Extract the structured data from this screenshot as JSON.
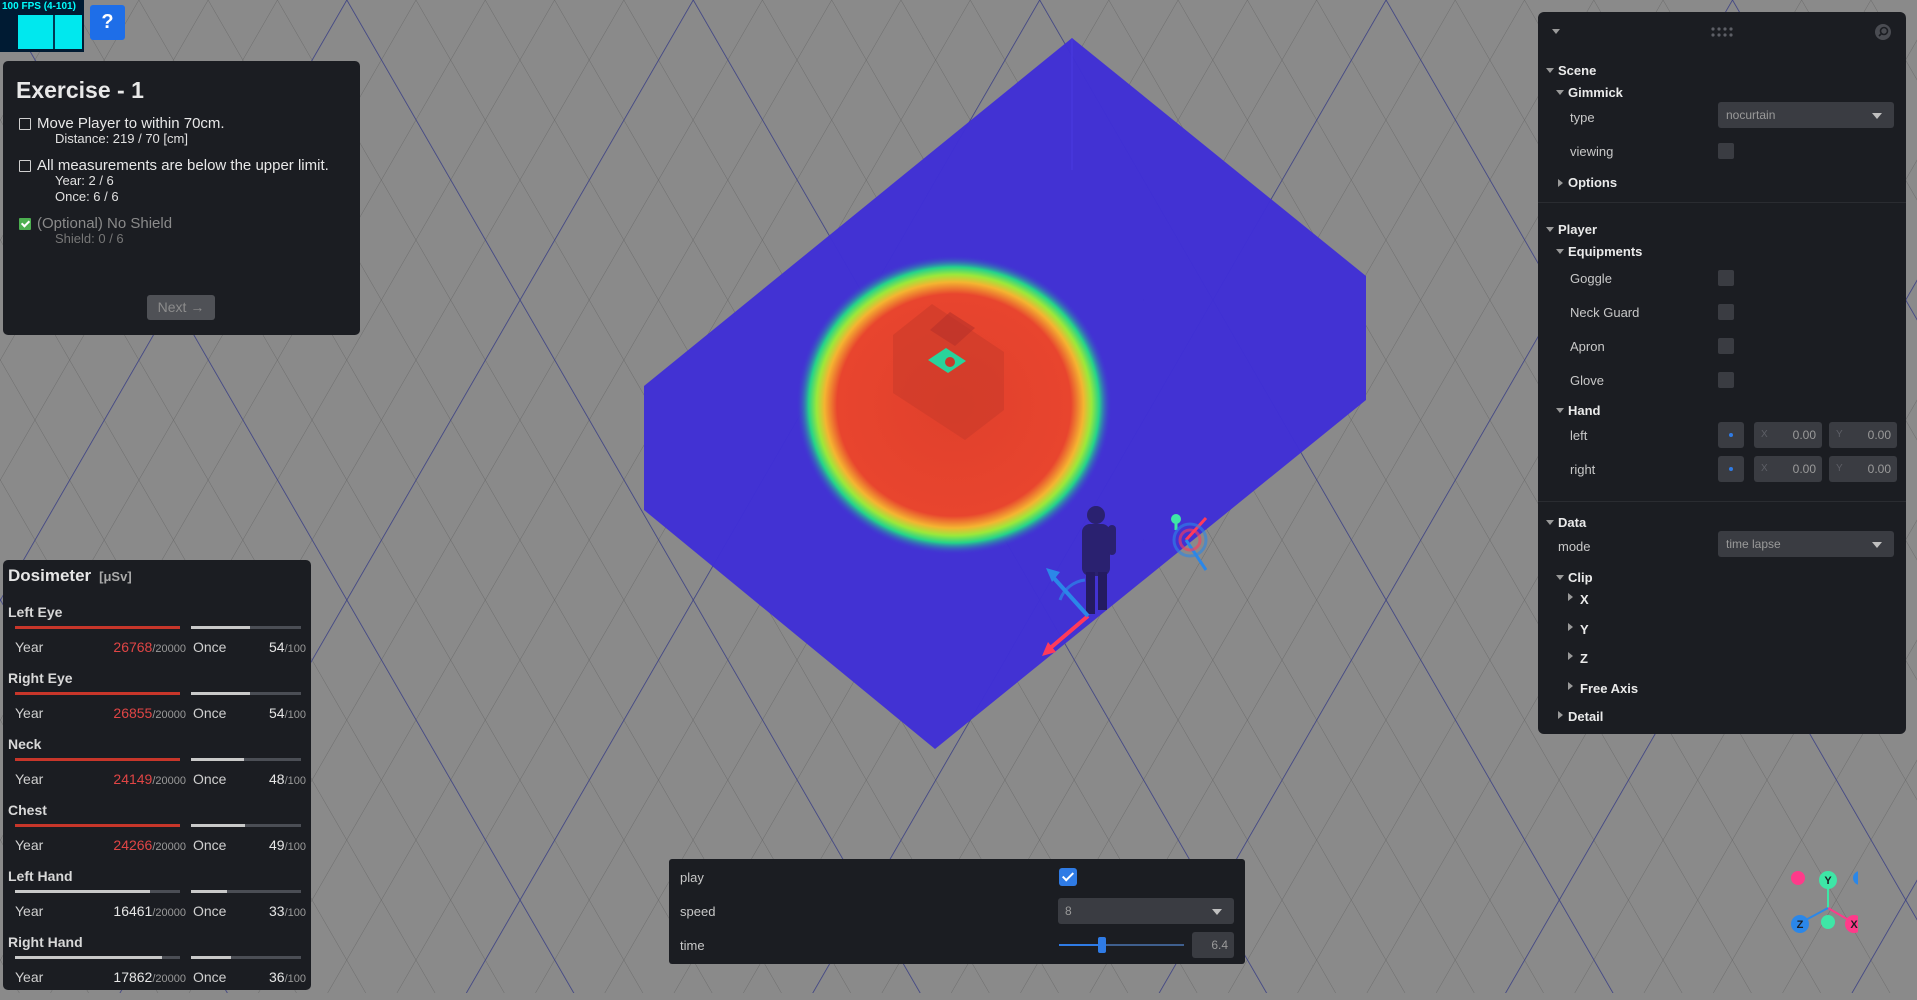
{
  "fps": {
    "label": "100 FPS (4-101)"
  },
  "help": {
    "label": "?"
  },
  "exercise": {
    "title": "Exercise - 1",
    "tasks": [
      {
        "label": "Move Player to within 70cm.",
        "details": [
          "Distance: 219 / 70 [cm]"
        ],
        "checked": false
      },
      {
        "label": "All measurements are below the upper limit.",
        "details": [
          "Year: 2 / 6",
          "Once: 6 / 6"
        ],
        "checked": false
      },
      {
        "label": "(Optional) No Shield",
        "details": [
          "Shield: 0 / 6"
        ],
        "checked": true
      }
    ],
    "next_label": "Next →"
  },
  "dosimeter": {
    "title": "Dosimeter",
    "unit": "[μSv]",
    "year_label": "Year",
    "once_label": "Once",
    "year_max": "/20000",
    "once_max": "/100",
    "parts": [
      {
        "name": "Left Eye",
        "year": "26768",
        "once": "54",
        "year_fraction": 1.0,
        "once_fraction": 0.54,
        "year_over": true
      },
      {
        "name": "Right Eye",
        "year": "26855",
        "once": "54",
        "year_fraction": 1.0,
        "once_fraction": 0.54,
        "year_over": true
      },
      {
        "name": "Neck",
        "year": "24149",
        "once": "48",
        "year_fraction": 1.0,
        "once_fraction": 0.48,
        "year_over": true
      },
      {
        "name": "Chest",
        "year": "24266",
        "once": "49",
        "year_fraction": 1.0,
        "once_fraction": 0.49,
        "year_over": true
      },
      {
        "name": "Left Hand",
        "year": "16461",
        "once": "33",
        "year_fraction": 0.82,
        "once_fraction": 0.33,
        "year_over": false
      },
      {
        "name": "Right Hand",
        "year": "17862",
        "once": "36",
        "year_fraction": 0.89,
        "once_fraction": 0.36,
        "year_over": false
      }
    ],
    "colors": {
      "over": "#c8362a",
      "normal": "#c9c9c9"
    }
  },
  "playback": {
    "play_label": "play",
    "play_checked": true,
    "speed_label": "speed",
    "speed_value": "8",
    "time_label": "time",
    "time_value": "6.4",
    "time_fraction": 0.34
  },
  "panel": {
    "scene": {
      "label": "Scene",
      "gimmick": {
        "label": "Gimmick",
        "type_label": "type",
        "type_value": "nocurtain",
        "viewing_label": "viewing"
      },
      "options_label": "Options"
    },
    "player": {
      "label": "Player",
      "equipments_label": "Equipments",
      "equipments": [
        "Goggle",
        "Neck Guard",
        "Apron",
        "Glove"
      ],
      "hand": {
        "label": "Hand",
        "rows": [
          {
            "label": "left",
            "x_axis": "X",
            "x": "0.00",
            "y_axis": "Y",
            "y": "0.00"
          },
          {
            "label": "right",
            "x_axis": "X",
            "x": "0.00",
            "y_axis": "Y",
            "y": "0.00"
          }
        ]
      }
    },
    "data": {
      "label": "Data",
      "mode_label": "mode",
      "mode_value": "time lapse",
      "clip": {
        "label": "Clip",
        "axes": [
          "X",
          "Y",
          "Z"
        ],
        "free_axis_label": "Free Axis"
      },
      "detail_label": "Detail"
    }
  },
  "gizmo": {
    "y": "Y",
    "z": "Z",
    "x": "X"
  },
  "colors": {
    "accent": "#2f7be5",
    "volume": "#3f2fd6",
    "hot": "#e0402c",
    "panel": "#1b1d22",
    "ground": "#8a8a8a"
  }
}
